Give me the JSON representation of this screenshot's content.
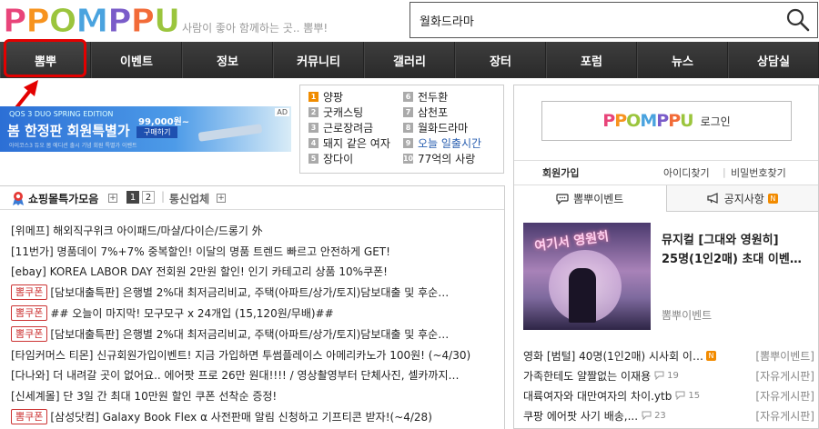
{
  "header": {
    "logo": [
      "P",
      "P",
      "O",
      "M",
      "P",
      "P",
      "U"
    ],
    "logo_colors": [
      "#e8457a",
      "#f7931e",
      "#9bc53d",
      "#4aa3df",
      "#7a5cc9",
      "#f26b38",
      "#9bc53d"
    ],
    "tagline": "사람이 좋아 함께하는 곳.. 뽐뿌!",
    "search_value": "월화드라마"
  },
  "nav": [
    "뽐뿌",
    "이벤트",
    "정보",
    "커뮤니티",
    "갤러리",
    "장터",
    "포럼",
    "뉴스",
    "상담실"
  ],
  "banner": {
    "line1": "QOS 3 DUO SPRING EDITION",
    "line2": "봄 한정판 회원특별가",
    "line3": "아이코스3 듀오 봄 에디션 출시 기념 회원 특별가 이벤트",
    "price": "99,000원~",
    "buy": "구매하기",
    "ad": "AD"
  },
  "ranking": {
    "left": [
      {
        "num": "1",
        "text": "양팡"
      },
      {
        "num": "2",
        "text": "굿캐스팅"
      },
      {
        "num": "3",
        "text": "근로장려금"
      },
      {
        "num": "4",
        "text": "돼지 같은 여자"
      },
      {
        "num": "5",
        "text": "장다이"
      }
    ],
    "right": [
      {
        "num": "6",
        "text": "전두환"
      },
      {
        "num": "7",
        "text": "삼천포"
      },
      {
        "num": "8",
        "text": "월화드라마"
      },
      {
        "num": "9",
        "text": "오늘 일출시간"
      },
      {
        "num": "10",
        "text": "77억의 사랑"
      }
    ]
  },
  "shop": {
    "title": "쇼핑몰특가모음",
    "page1": "1",
    "page2": "2",
    "telecom": "통신업체",
    "coupon_label": "뽐쿠폰",
    "rows": [
      {
        "coupon": false,
        "text": "[위메프] 해외직구위크 아이패드/마샬/다이슨/드롱기 外"
      },
      {
        "coupon": false,
        "text": "[11번가] 명품데이 7%+7% 중복할인! 이달의 명품 트렌드 빠르고 안전하게 GET!"
      },
      {
        "coupon": false,
        "text": "[ebay] KOREA LABOR DAY 전회원 2만원 할인! 인기 카테고리 상품 10%쿠폰!"
      },
      {
        "coupon": true,
        "text": "[담보대출특판] 은행별 2%대 최저금리비교, 주택(아파트/상가/토지)담보대출 및 후순…"
      },
      {
        "coupon": true,
        "text": "## 오늘이 마지막! 모구모구 x 24개입 (15,120원/무배)##"
      },
      {
        "coupon": true,
        "text": "[담보대출특판] 은행별 2%대 최저금리비교, 주택(아파트/상가/토지)담보대출 및 후순…"
      },
      {
        "coupon": false,
        "text": "[타임커머스 티몬] 신규회원가입이벤트! 지금 가입하면 투썸플레이스 아메리카노가 100원! (~4/30)"
      },
      {
        "coupon": false,
        "text": "[다나와] 더 내려갈 곳이 없어요.. 에어팟 프로 26만 원대!!!! / 영상촬영부터 단체사진, 셀카까지…"
      },
      {
        "coupon": false,
        "text": "[신세계몰] 단 3일 간 최대 10만원 할인 쿠폰 선착순 증정!"
      },
      {
        "coupon": true,
        "text": "[삼성닷컴] Galaxy Book Flex α 사전판매 알림 신청하고 기프티콘 받자!(~4/28)"
      }
    ]
  },
  "right": {
    "login_logo": "PPOMPPU",
    "login_label": "로그인",
    "join": "회원가입",
    "find_id": "아이디찾기",
    "find_pw": "비밀번호찾기",
    "tab_event": "뽐뿌이벤트",
    "tab_notice": "공지사항",
    "new_badge": "N",
    "feature_img_text": "여기서 영원히",
    "feature_title_1": "뮤지컬 [그대와 영원히]",
    "feature_title_2": "25명(1인2매) 초대 이벤…",
    "feature_src": "뽐뿌이벤트",
    "posts": [
      {
        "title": "영화 [범털] 40명(1인2매) 시사회 이…",
        "new": true,
        "comments": "",
        "board": "[뽐뿌이벤트]"
      },
      {
        "title": "가족한테도 얄짤없는 이재용",
        "new": false,
        "comments": "19",
        "board": "[자유게시판]"
      },
      {
        "title": "대륙여자와 대만여자의 차이.ytb",
        "new": false,
        "comments": "15",
        "board": "[자유게시판]"
      },
      {
        "title": "쿠팡 에어팟 사기 배송,...",
        "new": false,
        "comments": "23",
        "board": "[자유게시판]"
      }
    ]
  }
}
